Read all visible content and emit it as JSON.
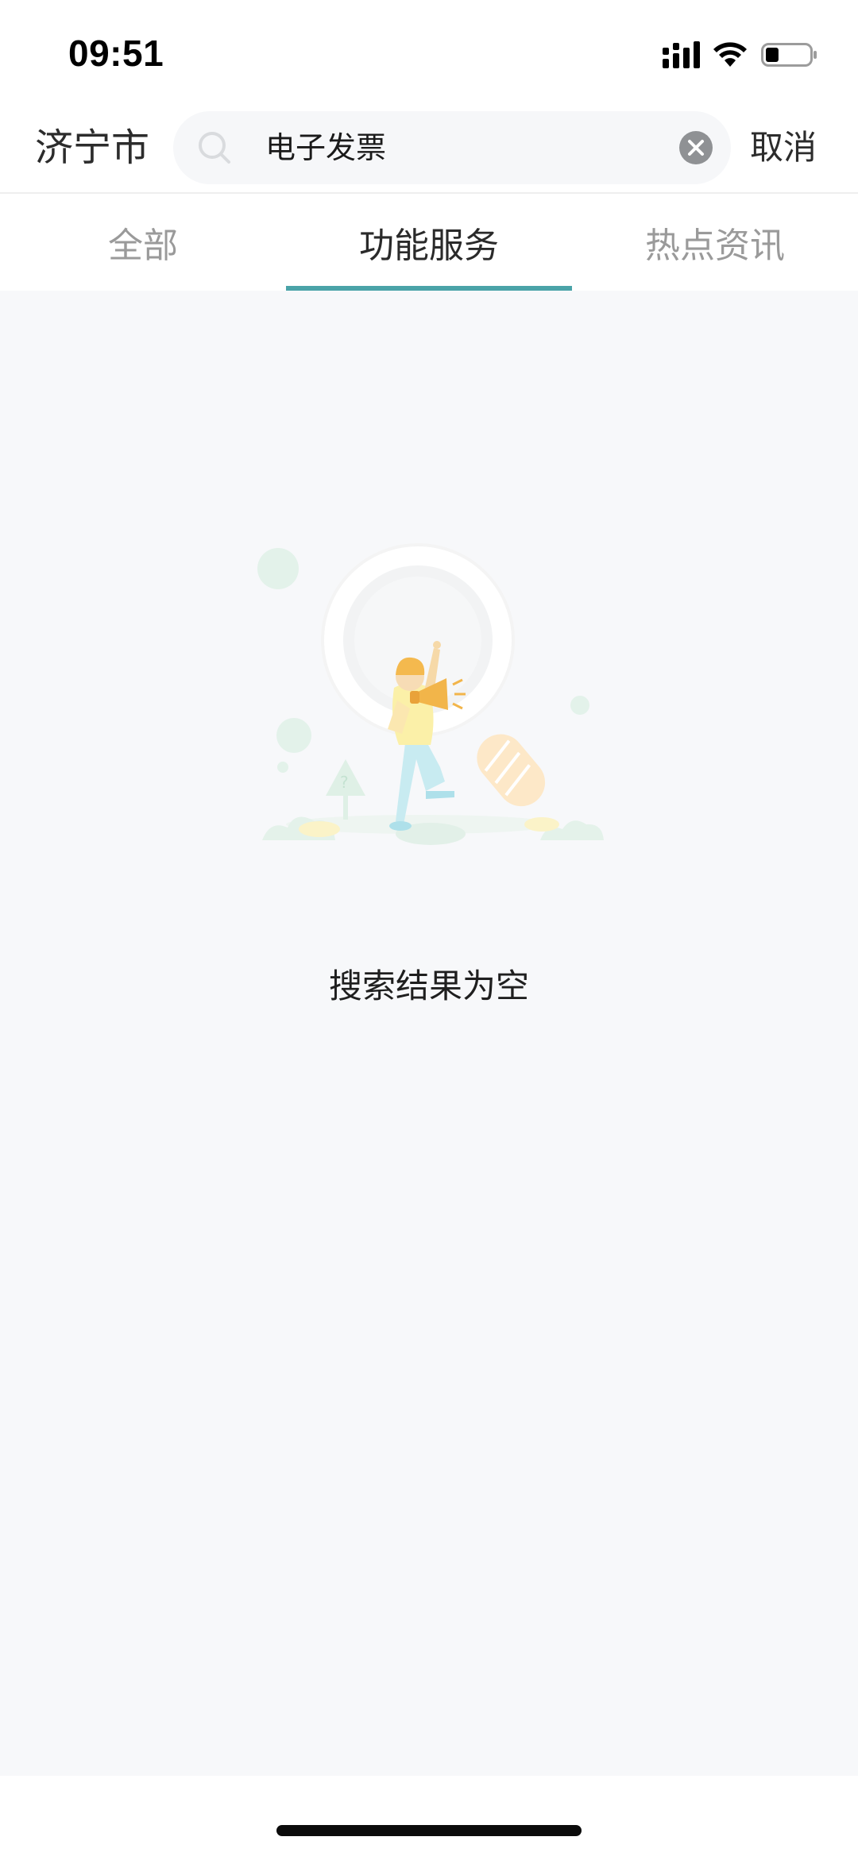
{
  "status_bar": {
    "time": "09:51",
    "icons": [
      "cellular-signal-icon",
      "wifi-icon",
      "battery-icon"
    ],
    "battery_level": 0.3
  },
  "header": {
    "city": "济宁市",
    "search": {
      "value": "电子发票",
      "icon": "search-icon",
      "clear_icon": "clear-icon"
    },
    "cancel_label": "取消"
  },
  "tabs": [
    {
      "label": "全部",
      "active": false
    },
    {
      "label": "功能服务",
      "active": true
    },
    {
      "label": "热点资讯",
      "active": false
    }
  ],
  "empty_state": {
    "illustration": "empty-search-illustration",
    "message": "搜索结果为空"
  },
  "colors": {
    "accent": "#4aa3a8",
    "content_background": "#f7f8fa",
    "tab_inactive": "#9a9a9a",
    "tab_active": "#2a2a2a"
  }
}
